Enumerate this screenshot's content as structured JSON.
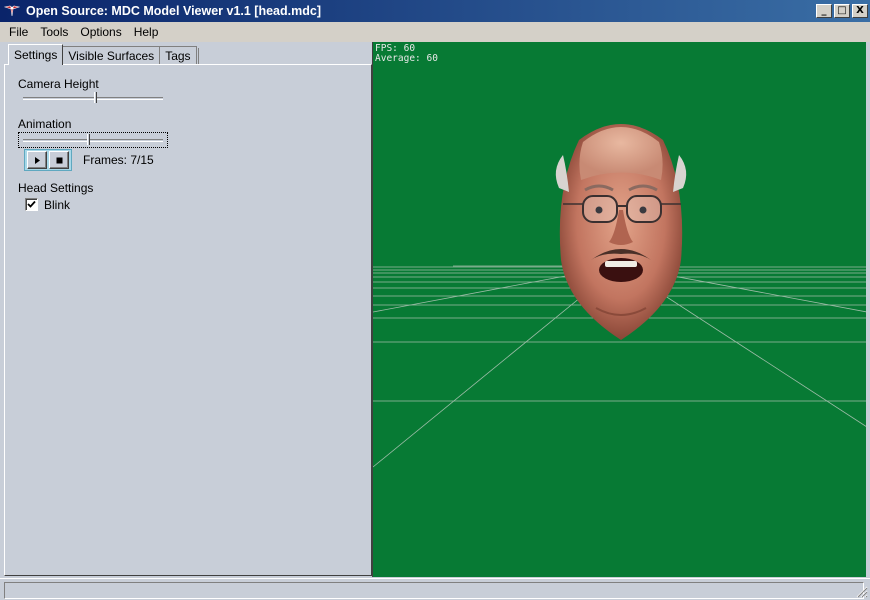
{
  "window": {
    "title": "Open Source: MDC Model Viewer v1.1 [head.mdc]",
    "minimize_glyph": "_",
    "maximize_glyph": "□",
    "close_glyph": "X"
  },
  "menu": {
    "file": "File",
    "tools": "Tools",
    "options": "Options",
    "help": "Help"
  },
  "tabs": {
    "settings": "Settings",
    "visible_surfaces": "Visible Surfaces",
    "tags": "Tags"
  },
  "settings": {
    "camera_height_label": "Camera Height",
    "camera_height_value": 0.52,
    "animation_label": "Animation",
    "animation_value": 0.47,
    "frames_text": "Frames: 7/15",
    "head_settings_label": "Head Settings",
    "blink_label": "Blink",
    "blink_checked": true
  },
  "viewport": {
    "fps_line": "FPS: 60",
    "average_line": "Average: 60",
    "background_color": "#077a34",
    "grid_color": "#b8c8bc"
  },
  "icons": {
    "app": "red-winged-emblem-icon",
    "play": "play-icon",
    "stop": "stop-icon",
    "check": "checkmark-icon",
    "grip": "resize-grip-icon"
  }
}
